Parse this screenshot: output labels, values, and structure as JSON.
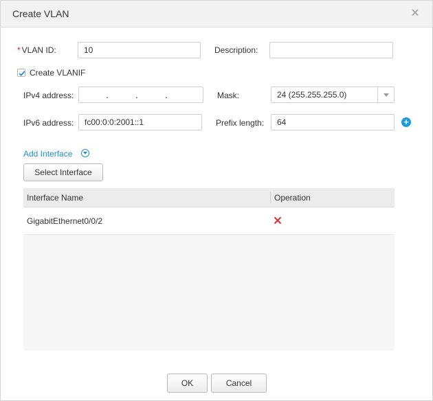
{
  "dialog": {
    "title": "Create VLAN",
    "close_icon": "close-icon"
  },
  "form": {
    "vlan_id": {
      "required_mark": "*",
      "label": "VLAN ID:",
      "value": "10"
    },
    "description": {
      "label": "Description:",
      "value": ""
    },
    "create_vlanif": {
      "label": "Create VLANIF",
      "checked": true
    },
    "ipv4": {
      "label": "IPv4 address:",
      "separators": [
        ".",
        ".",
        "."
      ]
    },
    "mask": {
      "label": "Mask:",
      "value": "24 (255.255.255.0)"
    },
    "ipv6": {
      "label": "IPv6 address:",
      "value": "fc00:0:0:2001::1"
    },
    "prefix": {
      "label": "Prefix length:",
      "value": "64"
    },
    "add_icon": "plus-circle-icon"
  },
  "interfaces": {
    "add_link": "Add Interface",
    "toggle_icon": "chevron-down-circle-icon",
    "select_button": "Select Interface",
    "columns": [
      "Interface Name",
      "Operation"
    ],
    "rows": [
      {
        "name": "GigabitEthernet0/0/2",
        "operation_icon": "delete-x-icon"
      }
    ]
  },
  "footer": {
    "ok": "OK",
    "cancel": "Cancel"
  },
  "colors": {
    "accent": "#1a8fd8",
    "delete": "#e03030",
    "required": "#e02020"
  }
}
